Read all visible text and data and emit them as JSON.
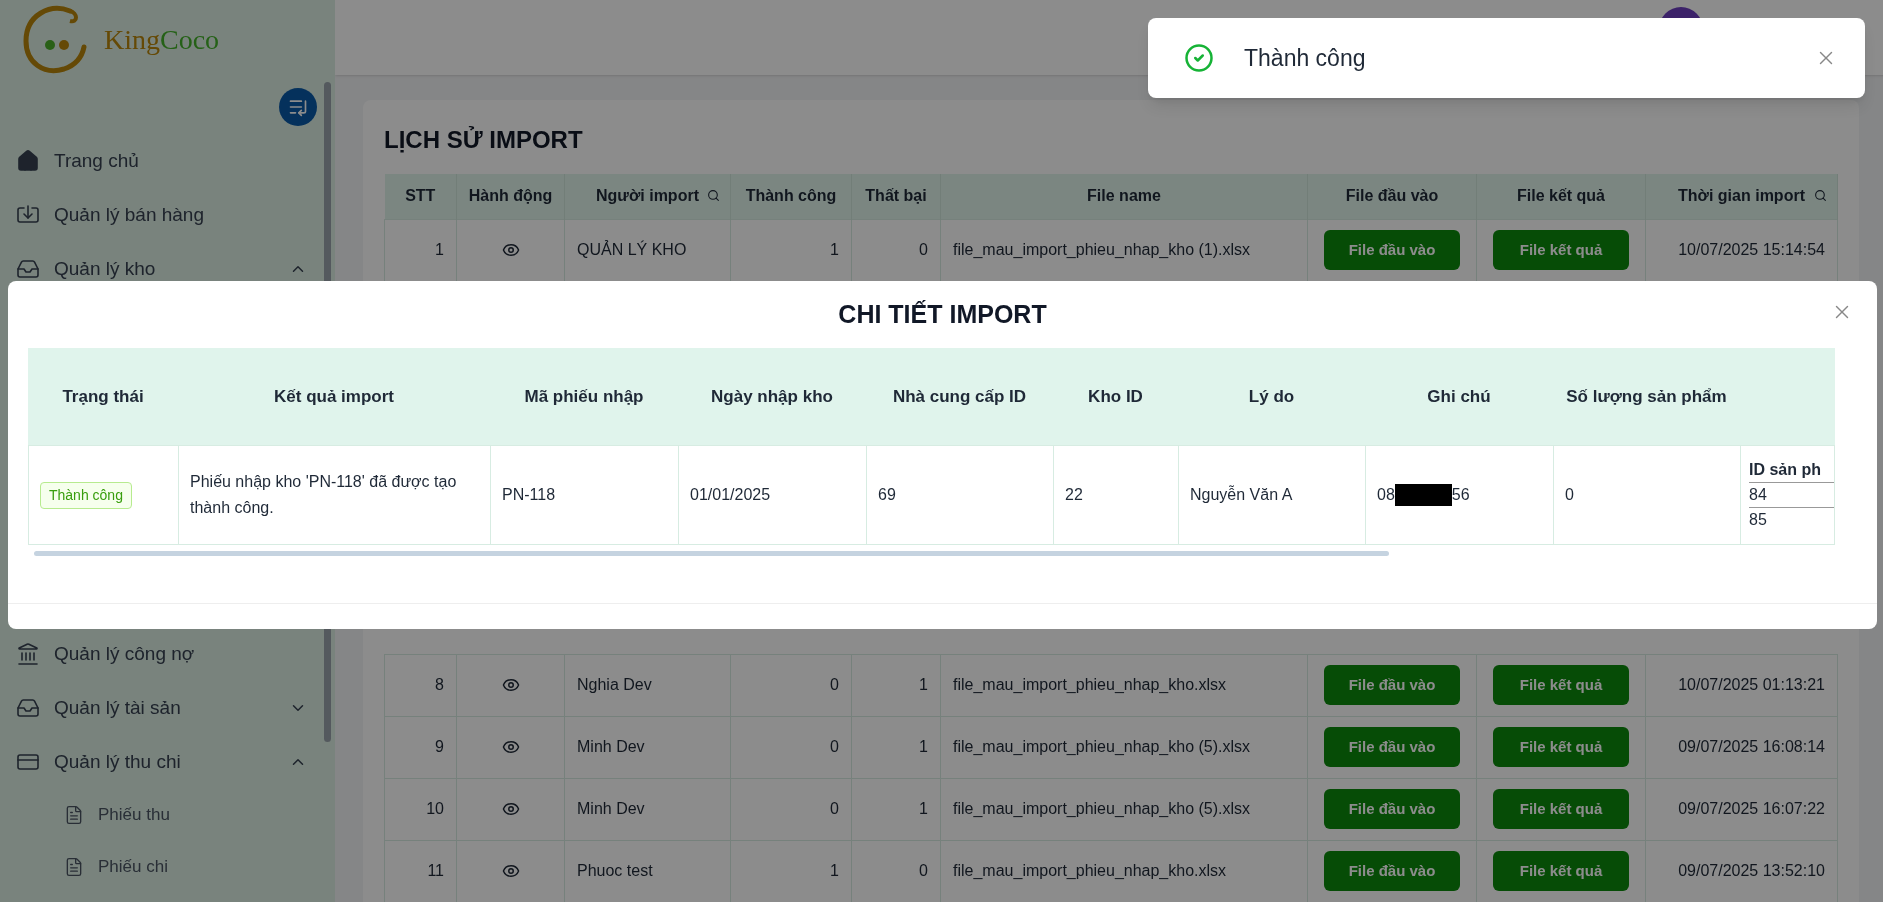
{
  "sidebar": {
    "brand": {
      "first": "King",
      "second": "Coco"
    },
    "menu_top": [
      {
        "kind": "link",
        "label": "Trang chủ"
      },
      {
        "kind": "link",
        "label": "Quản lý bán hàng"
      },
      {
        "kind": "group",
        "label": "Quản lý kho",
        "expanded": true
      }
    ],
    "menu_bottom": [
      {
        "kind": "link",
        "label": "Quản lý công nợ"
      },
      {
        "kind": "group",
        "label": "Quản lý tài sản",
        "expanded": false
      },
      {
        "kind": "group",
        "label": "Quản lý thu chi",
        "expanded": true
      },
      {
        "kind": "sub",
        "label": "Phiếu thu"
      },
      {
        "kind": "sub",
        "label": "Phiếu chi"
      }
    ]
  },
  "history": {
    "title": "LỊCH SỬ IMPORT",
    "columns": [
      {
        "label": "STT",
        "searchable": false
      },
      {
        "label": "Hành động",
        "searchable": false
      },
      {
        "label": "Người import",
        "searchable": true
      },
      {
        "label": "Thành công",
        "searchable": false
      },
      {
        "label": "Thất bại",
        "searchable": false
      },
      {
        "label": "File name",
        "searchable": false
      },
      {
        "label": "File đầu vào",
        "searchable": false
      },
      {
        "label": "File kết quả",
        "searchable": false
      },
      {
        "label": "Thời gian import",
        "searchable": true
      }
    ],
    "rows_above_dialog": [
      {
        "stt": "1",
        "user": "QUẢN LÝ KHO",
        "success": "1",
        "failed": "0",
        "file_name": "file_mau_import_phieu_nhap_kho (1).xlsx",
        "input_button": "File đầu vào",
        "result_button": "File kết quả",
        "time": "10/07/2025 15:14:54"
      }
    ],
    "rows_below_dialog": [
      {
        "stt": "8",
        "user": "Nghia Dev",
        "success": "0",
        "failed": "1",
        "file_name": "file_mau_import_phieu_nhap_kho.xlsx",
        "input_button": "File đầu vào",
        "result_button": "File kết quả",
        "time": "10/07/2025 01:13:21"
      },
      {
        "stt": "9",
        "user": "Minh Dev",
        "success": "0",
        "failed": "1",
        "file_name": "file_mau_import_phieu_nhap_kho (5).xlsx",
        "input_button": "File đầu vào",
        "result_button": "File kết quả",
        "time": "09/07/2025 16:08:14"
      },
      {
        "stt": "10",
        "user": "Minh Dev",
        "success": "0",
        "failed": "1",
        "file_name": "file_mau_import_phieu_nhap_kho (5).xlsx",
        "input_button": "File đầu vào",
        "result_button": "File kết quả",
        "time": "09/07/2025 16:07:22"
      },
      {
        "stt": "11",
        "user": "Phuoc test",
        "success": "1",
        "failed": "0",
        "file_name": "file_mau_import_phieu_nhap_kho.xlsx",
        "input_button": "File đầu vào",
        "result_button": "File kết quả",
        "time": "09/07/2025 13:52:10"
      }
    ]
  },
  "dialog": {
    "title": "CHI TIẾT IMPORT",
    "columns": [
      "Trạng thái",
      "Kết quả import",
      "Mã phiếu nhập",
      "Ngày nhập kho",
      "Nhà cung cấp ID",
      "Kho ID",
      "Lý do",
      "Ghi chú",
      "Số lượng sản phẩm"
    ],
    "rows": [
      {
        "status": {
          "kind": "success",
          "label": "Thành công"
        },
        "result": "Phiếu nhập kho 'PN-118' đã được tạo thành công.",
        "code": "PN-118",
        "date": "01/01/2025",
        "supplier_id": "69",
        "warehouse_id": "22",
        "reason": "Nguyễn Văn A",
        "note": {
          "before": "08",
          "redacted": true,
          "after": "56"
        },
        "quantity": "0",
        "products": {
          "heading": "ID sản ph",
          "ids": [
            "84",
            "85"
          ]
        }
      }
    ]
  },
  "toast": {
    "kind": "success",
    "message": "Thành công"
  }
}
